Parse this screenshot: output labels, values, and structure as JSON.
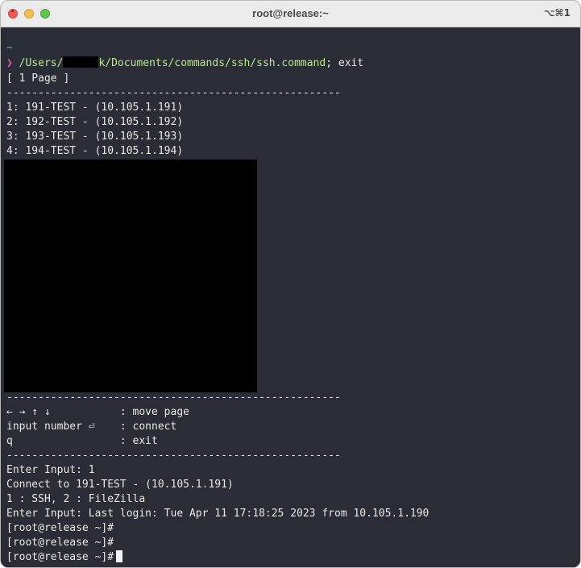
{
  "window": {
    "title": "root@release:~",
    "shortcut": "⌥⌘1"
  },
  "colors": {
    "terminal_bg": "#2b2d36",
    "prompt_arrow": "#e056b0",
    "command": "#b8e986",
    "tilde": "#63b7c8"
  },
  "terminal": {
    "cwd_marker": "~",
    "prompt_symbol": "❯",
    "command": {
      "path_prefix": "/Users/",
      "path_suffix": "k/Documents/commands/ssh/ssh.command",
      "rest": "; exit"
    },
    "page_header": "[ 1 Page ]",
    "separator": "-----------------------------------------------------",
    "servers": [
      "1: 191-TEST - (10.105.1.191)",
      "2: 192-TEST - (10.105.1.192)",
      "3: 193-TEST - (10.105.1.193)",
      "4: 194-TEST - (10.105.1.194)"
    ],
    "help": [
      "← → ↑ ↓           : move page",
      "input number ⏎    : connect",
      "q                 : exit"
    ],
    "session": [
      "Enter Input: 1",
      "Connect to 191-TEST - (10.105.1.191)",
      "1 : SSH, 2 : FileZilla",
      "Enter Input: Last login: Tue Apr 11 17:18:25 2023 from 10.105.1.190",
      "[root@release ~]#",
      "[root@release ~]#",
      "[root@release ~]#"
    ]
  }
}
